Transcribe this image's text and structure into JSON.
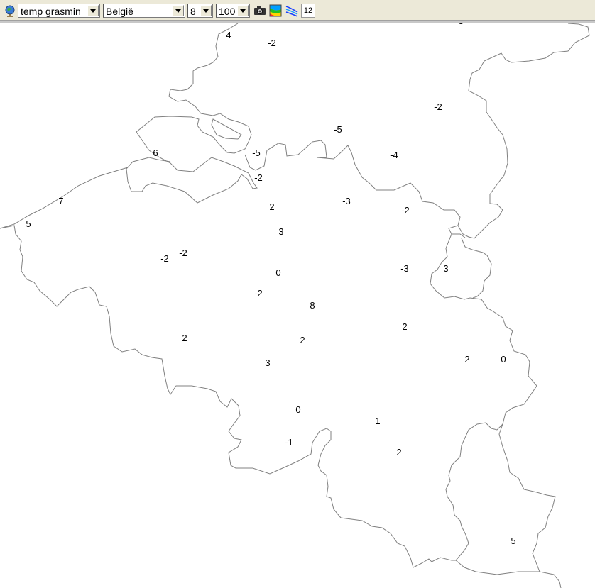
{
  "toolbar": {
    "variable_select": "temp grasmin",
    "region_select": "België",
    "hour_select": "8",
    "zoom_select": "100",
    "count_chip": "12",
    "icons": [
      "globe-icon",
      "camera-icon",
      "color-map-icon",
      "contour-lines-icon"
    ]
  },
  "map": {
    "background": "#ffffff",
    "border_color": "#808080",
    "labels": [
      {
        "text": "4"
      },
      {
        "text": "-2"
      },
      {
        "text": "-3"
      },
      {
        "text": "-2"
      },
      {
        "text": "-5"
      },
      {
        "text": "6"
      },
      {
        "text": "-5"
      },
      {
        "text": "-4"
      },
      {
        "text": "-2"
      },
      {
        "text": "7"
      },
      {
        "text": "2"
      },
      {
        "text": "-3"
      },
      {
        "text": "-2"
      },
      {
        "text": "5"
      },
      {
        "text": "3"
      },
      {
        "text": "-2"
      },
      {
        "text": "-2"
      },
      {
        "text": "0"
      },
      {
        "text": "-3"
      },
      {
        "text": "3"
      },
      {
        "text": "-2"
      },
      {
        "text": "8"
      },
      {
        "text": "2"
      },
      {
        "text": "2"
      },
      {
        "text": "2"
      },
      {
        "text": "3"
      },
      {
        "text": "2"
      },
      {
        "text": "0"
      },
      {
        "text": "0"
      },
      {
        "text": "1"
      },
      {
        "text": "-1"
      },
      {
        "text": "2"
      },
      {
        "text": "5"
      }
    ]
  }
}
